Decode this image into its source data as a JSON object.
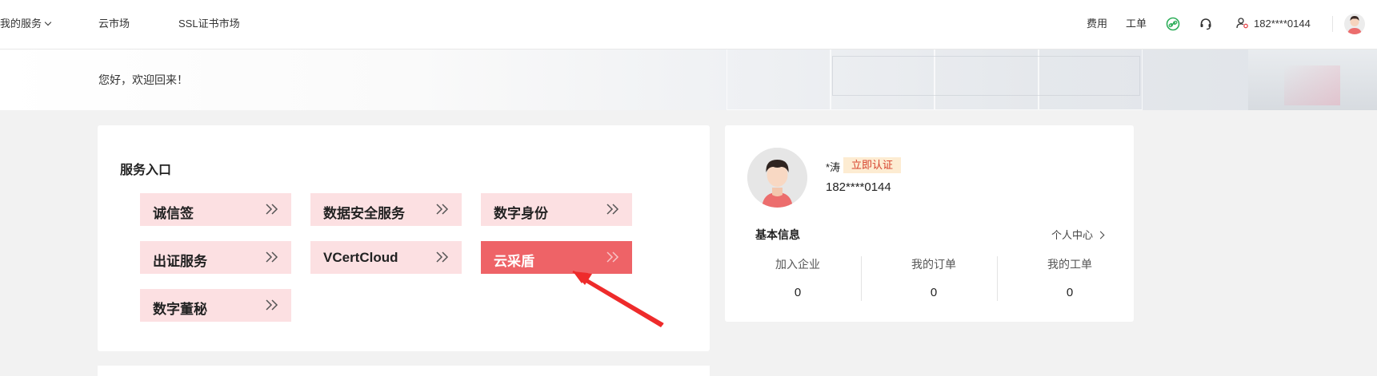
{
  "topbar": {
    "my_services": "我的服务",
    "cloud_market": "云市场",
    "ssl_market": "SSL证书市场",
    "fees": "费用",
    "tickets": "工单",
    "user_phone": "182****0144",
    "icons": [
      "link-icon",
      "headset-icon",
      "user-settings-icon"
    ]
  },
  "banner": {
    "greeting": "您好，欢迎回来！"
  },
  "services": {
    "title": "服务入口",
    "items": [
      {
        "label": "诚信签"
      },
      {
        "label": "数据安全服务"
      },
      {
        "label": "数字身份"
      },
      {
        "label": "出证服务"
      },
      {
        "label": "VCertCloud"
      },
      {
        "label": "云采盾"
      },
      {
        "label": "数字董秘"
      }
    ],
    "active_item": "云采盾",
    "accent_color": "#ee6367",
    "button_color": "#fce0e2"
  },
  "profile": {
    "username": "*涛",
    "verify_label": "立即认证",
    "phone": "182****0144",
    "basic_info_label": "基本信息",
    "personal_center_label": "个人中心",
    "stats": [
      {
        "label": "加入企业",
        "value": "0"
      },
      {
        "label": "我的订单",
        "value": "0"
      },
      {
        "label": "我的工单",
        "value": "0"
      }
    ]
  }
}
